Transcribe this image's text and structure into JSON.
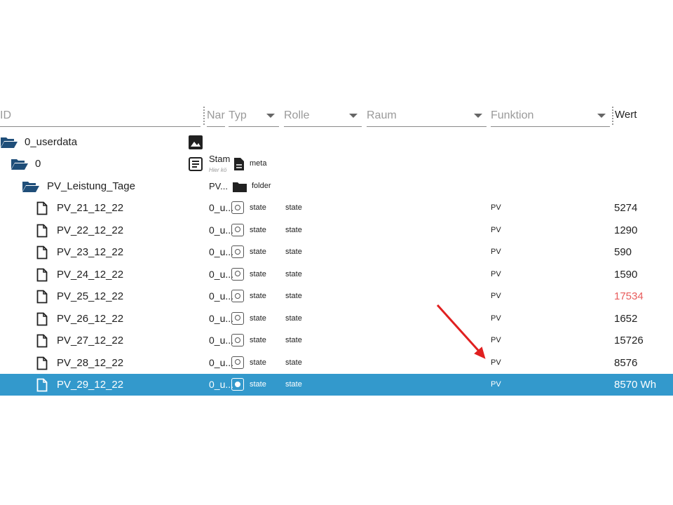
{
  "header": {
    "id_placeholder": "ID",
    "name_placeholder": "Nar",
    "typ_label": "Typ",
    "rolle_label": "Rolle",
    "raum_label": "Raum",
    "funktion_label": "Funktion",
    "wert_label": "Wert"
  },
  "tree": {
    "root": {
      "label": "0_userdata"
    },
    "instance": {
      "label": "0",
      "name": "Stam",
      "name_sub": "Hier kö",
      "type": "meta"
    },
    "folder": {
      "label": "PV_Leistung_Tage",
      "name": "PV...",
      "type": "folder"
    }
  },
  "states": [
    {
      "id": "PV_21_12_22",
      "name": "0_u...",
      "type": "state",
      "role": "state",
      "function": "PV",
      "value": "5274",
      "value_color": "#212121",
      "selected": false
    },
    {
      "id": "PV_22_12_22",
      "name": "0_u...",
      "type": "state",
      "role": "state",
      "function": "PV",
      "value": "1290",
      "value_color": "#212121",
      "selected": false
    },
    {
      "id": "PV_23_12_22",
      "name": "0_u...",
      "type": "state",
      "role": "state",
      "function": "PV",
      "value": "590",
      "value_color": "#212121",
      "selected": false
    },
    {
      "id": "PV_24_12_22",
      "name": "0_u...",
      "type": "state",
      "role": "state",
      "function": "PV",
      "value": "1590",
      "value_color": "#212121",
      "selected": false
    },
    {
      "id": "PV_25_12_22",
      "name": "0_u...",
      "type": "state",
      "role": "state",
      "function": "PV",
      "value": "17534",
      "value_color": "#e85c5c",
      "selected": false
    },
    {
      "id": "PV_26_12_22",
      "name": "0_u...",
      "type": "state",
      "role": "state",
      "function": "PV",
      "value": "1652",
      "value_color": "#212121",
      "selected": false
    },
    {
      "id": "PV_27_12_22",
      "name": "0_u...",
      "type": "state",
      "role": "state",
      "function": "PV",
      "value": "15726",
      "value_color": "#212121",
      "selected": false
    },
    {
      "id": "PV_28_12_22",
      "name": "0_u...",
      "type": "state",
      "role": "state",
      "function": "PV",
      "value": "8576",
      "value_color": "#212121",
      "selected": false
    },
    {
      "id": "PV_29_12_22",
      "name": "0_u...",
      "type": "state",
      "role": "state",
      "function": "PV",
      "value": "8570 Wh",
      "value_color": "#ffffff",
      "selected": true
    }
  ],
  "colors": {
    "selection": "#3399cc",
    "annotation_arrow": "#e02020",
    "folder_icon": "#1f4e79"
  },
  "icons": {
    "folder_open": "folder-open-icon",
    "file": "file-icon",
    "image": "image-icon",
    "document": "document-icon",
    "state": "state-icon",
    "folder": "folder-icon"
  }
}
